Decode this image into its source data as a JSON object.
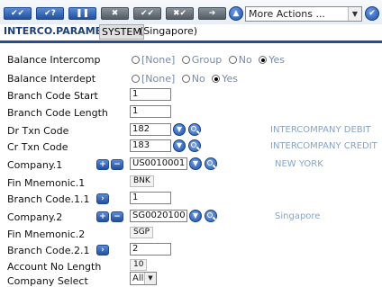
{
  "toolbar": {
    "buttons": [
      {
        "name": "commit-button",
        "glyph": "✔✔",
        "style": "blue"
      },
      {
        "name": "validate-button",
        "glyph": "✔?",
        "style": "blue"
      },
      {
        "name": "hold-button",
        "glyph": "❚❚",
        "style": "blue"
      },
      {
        "name": "delete-button",
        "glyph": "✖",
        "style": "grey"
      },
      {
        "name": "authorise-button",
        "glyph": "✔✔",
        "style": "grey"
      },
      {
        "name": "reverse-button",
        "glyph": "✖✔",
        "style": "grey"
      },
      {
        "name": "next-button",
        "glyph": "➔",
        "style": "grey"
      }
    ],
    "more_actions": "More Actions ..."
  },
  "title": {
    "app": "INTERCO.PARAMETER",
    "system": "SYSTEM",
    "company": "(Singapore)"
  },
  "form": {
    "balance_intercomp": {
      "label": "Balance Intercomp",
      "options": [
        "[None]",
        "Group",
        "No",
        "Yes"
      ],
      "selected": "Yes"
    },
    "balance_interdept": {
      "label": "Balance Interdept",
      "options": [
        "[None]",
        "No",
        "Yes"
      ],
      "selected": "Yes"
    },
    "branch_code_start": {
      "label": "Branch Code Start",
      "value": "1"
    },
    "branch_code_length": {
      "label": "Branch Code Length",
      "value": "1"
    },
    "dr_txn_code": {
      "label": "Dr Txn Code",
      "value": "182",
      "desc": "INTERCOMPANY DEBIT"
    },
    "cr_txn_code": {
      "label": "Cr Txn Code",
      "value": "183",
      "desc": "INTERCOMPANY CREDIT"
    },
    "company_1": {
      "label": "Company.1",
      "value": "US0010001",
      "desc": "NEW YORK"
    },
    "fin_mnemonic_1": {
      "label": "Fin Mnemonic.1",
      "value": "BNK"
    },
    "branch_code_1_1": {
      "label": "Branch Code.1.1",
      "value": "1"
    },
    "company_2": {
      "label": "Company.2",
      "value": "SG0020100",
      "desc": "Singapore"
    },
    "fin_mnemonic_2": {
      "label": "Fin Mnemonic.2",
      "value": "SGP"
    },
    "branch_code_2_1": {
      "label": "Branch Code.2.1",
      "value": "2"
    },
    "account_no_length": {
      "label": "Account No Length",
      "value": "10"
    },
    "company_select": {
      "label": "Company Select",
      "value": "All"
    }
  },
  "colors": {
    "accent": "#1f4f9a",
    "desc_text": "#8aa3c4"
  }
}
